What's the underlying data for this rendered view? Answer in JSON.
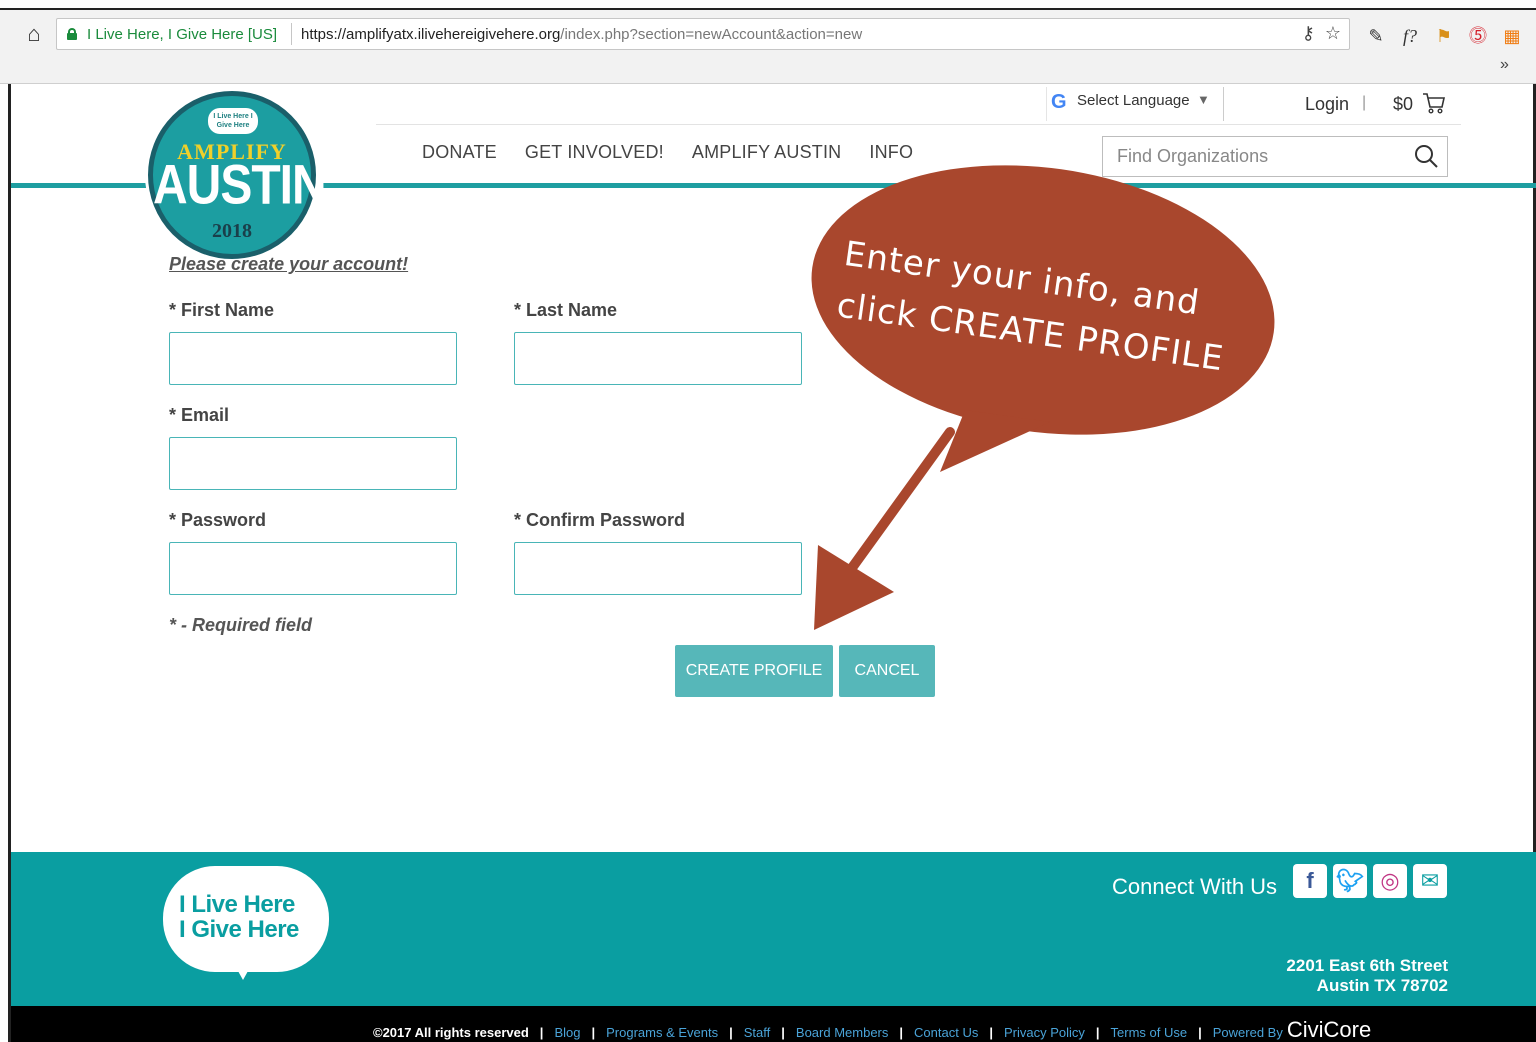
{
  "browser": {
    "site_name": "I Live Here, I Give Here [US]",
    "url_host": "https://amplifyatx.ilivehereigivehere.org",
    "url_path": "/index.php?section=newAccount&action=new",
    "more_label": "»"
  },
  "logo": {
    "badge": "I Live Here I Give Here",
    "amplify": "AMPLIFY",
    "austin": "AUSTIN",
    "year": "2018"
  },
  "header": {
    "language_label": "Select Language",
    "language_caret": "▼",
    "login": "Login",
    "login_sep": "|",
    "cart_amount": "$0",
    "search_placeholder": "Find Organizations"
  },
  "nav": {
    "items": [
      {
        "label": "DONATE"
      },
      {
        "label": "GET INVOLVED!"
      },
      {
        "label": "AMPLIFY AUSTIN"
      },
      {
        "label": "INFO"
      }
    ]
  },
  "form": {
    "title": "Please create your account!",
    "first_name_label": "* First Name",
    "last_name_label": "* Last Name",
    "email_label": "* Email",
    "password_label": "* Password",
    "confirm_password_label": "* Confirm Password",
    "required_note": "* - Required field",
    "create_label": "CREATE PROFILE",
    "cancel_label": "CANCEL"
  },
  "callout": {
    "line1": "Enter your info, and",
    "line2": "click CREATE PROFILE",
    "fill_color": "#a9472d"
  },
  "footer": {
    "logo_line1": "I Live Here",
    "logo_line2": "I Give Here",
    "connect": "Connect With Us",
    "address_line1": "2201 East 6th Street",
    "address_line2": "Austin TX 78702",
    "copyright": "©2017 All rights reserved",
    "links": [
      "Blog",
      "Programs & Events",
      "Staff",
      "Board Members",
      "Contact Us",
      "Privacy Policy",
      "Terms of Use",
      "Powered By"
    ],
    "powered_brand": "CiviCore"
  },
  "colors": {
    "teal": "#0a9ea1",
    "input_border": "#49b5b7",
    "button": "#56b7b9"
  }
}
